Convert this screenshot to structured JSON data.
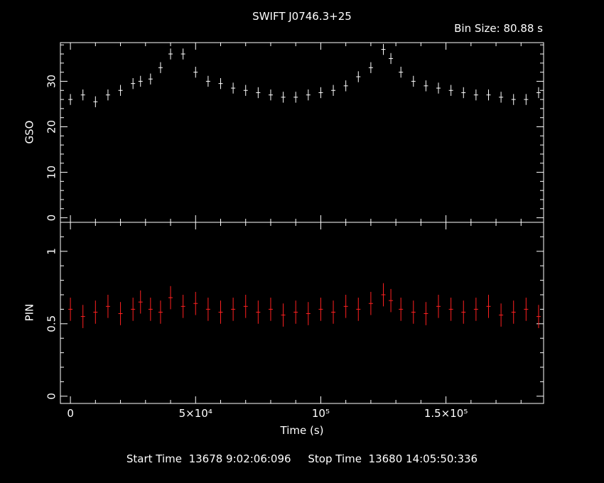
{
  "title": "SWIFT J0746.3+25",
  "bin_size_label": "Bin Size:",
  "bin_size_value": "80.88 s",
  "footer": {
    "start_label": "Start Time",
    "start_value": "13678  9:02:06:096",
    "stop_label": "Stop Time",
    "stop_value": "13680 14:05:50:336"
  },
  "colors": {
    "gso": "#ffffff",
    "pin": "#ff2020",
    "axes": "#ffffff",
    "background": "#000000"
  },
  "chart_data": [
    {
      "type": "scatter",
      "panel": "top",
      "ylabel": "GSO",
      "xlabel": "",
      "xlim": [
        -4000,
        189000
      ],
      "ylim": [
        -1,
        38.5
      ],
      "yticks": [
        0,
        10,
        20,
        30
      ],
      "ytick_labels": [
        "0",
        "10",
        "20",
        "30"
      ],
      "series": [
        {
          "style": "error-bars",
          "color": "#ffffff",
          "x": [
            0,
            5000,
            10000,
            15000,
            20000,
            25000,
            28000,
            32000,
            36000,
            40000,
            45000,
            50000,
            55000,
            60000,
            65000,
            70000,
            75000,
            80000,
            85000,
            90000,
            95000,
            100000,
            105000,
            110000,
            115000,
            120000,
            125000,
            128000,
            132000,
            137000,
            142000,
            147000,
            152000,
            157000,
            162000,
            167000,
            172000,
            177000,
            182000,
            187000
          ],
          "y": [
            26,
            27,
            25.5,
            27,
            28,
            29.5,
            30,
            30.5,
            33,
            36,
            36,
            32,
            30,
            29.5,
            28.5,
            28,
            27.5,
            27,
            26.5,
            26.5,
            27,
            27.5,
            28,
            29,
            31,
            33,
            37,
            35,
            32,
            30,
            29,
            28.5,
            28,
            27.5,
            27,
            27,
            26.5,
            26,
            26,
            27.5
          ]
        }
      ]
    },
    {
      "type": "scatter",
      "panel": "bottom",
      "ylabel": "PIN",
      "xlabel": "Time (s)",
      "xlim": [
        -4000,
        189000
      ],
      "ylim": [
        -0.05,
        1.2
      ],
      "yticks": [
        0,
        0.5,
        1
      ],
      "ytick_labels": [
        "0",
        "0.5",
        "1"
      ],
      "xticks": [
        0,
        50000,
        100000,
        150000
      ],
      "xtick_labels": [
        "0",
        "5×10⁴",
        "10⁵",
        "1.5×10⁵"
      ],
      "series": [
        {
          "style": "error-bars",
          "color": "#ff2020",
          "x": [
            0,
            5000,
            10000,
            15000,
            20000,
            25000,
            28000,
            32000,
            36000,
            40000,
            45000,
            50000,
            55000,
            60000,
            65000,
            70000,
            75000,
            80000,
            85000,
            90000,
            95000,
            100000,
            105000,
            110000,
            115000,
            120000,
            125000,
            128000,
            132000,
            137000,
            142000,
            147000,
            152000,
            157000,
            162000,
            167000,
            172000,
            177000,
            182000,
            187000
          ],
          "y": [
            0.6,
            0.55,
            0.58,
            0.62,
            0.57,
            0.6,
            0.65,
            0.6,
            0.58,
            0.68,
            0.62,
            0.64,
            0.6,
            0.58,
            0.6,
            0.62,
            0.58,
            0.6,
            0.56,
            0.58,
            0.57,
            0.6,
            0.58,
            0.62,
            0.6,
            0.64,
            0.7,
            0.66,
            0.6,
            0.58,
            0.57,
            0.62,
            0.6,
            0.58,
            0.6,
            0.62,
            0.56,
            0.58,
            0.6,
            0.55
          ]
        }
      ]
    }
  ]
}
